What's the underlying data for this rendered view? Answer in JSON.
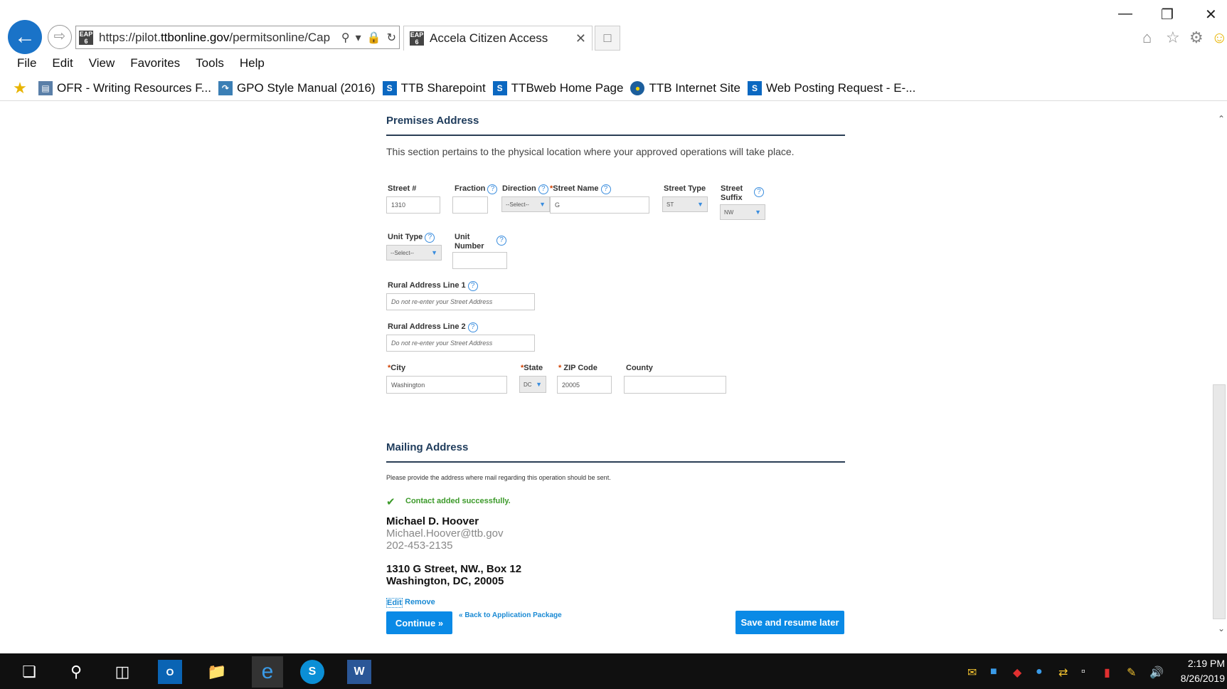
{
  "browser": {
    "url_prefix": "https://pilot.",
    "url_domain": "ttbonline.gov",
    "url_path": "/permitsonline/Cap",
    "tab_title": "Accela Citizen Access",
    "favicon_text": "EAP 6"
  },
  "menu": [
    "File",
    "Edit",
    "View",
    "Favorites",
    "Tools",
    "Help"
  ],
  "favorites": [
    {
      "label": "OFR - Writing Resources F...",
      "icon": "doc"
    },
    {
      "label": "GPO Style Manual (2016)",
      "icon": "gpo"
    },
    {
      "label": "TTB Sharepoint",
      "icon": "sp"
    },
    {
      "label": "TTBweb Home Page",
      "icon": "sp"
    },
    {
      "label": "TTB Internet Site",
      "icon": "seal"
    },
    {
      "label": "Web Posting Request - E-...",
      "icon": "sp"
    }
  ],
  "premises": {
    "title": "Premises Address",
    "description": "This section pertains to the physical location where your approved operations will take place.",
    "labels": {
      "street_no": "Street #",
      "fraction": "Fraction",
      "direction": "Direction",
      "street_name": "Street Name",
      "street_type": "Street Type",
      "street_suffix_1": "Street",
      "street_suffix_2": "Suffix",
      "unit_type": "Unit Type",
      "unit_number_1": "Unit",
      "unit_number_2": "Number",
      "rural1": "Rural Address Line 1",
      "rural2": "Rural Address Line 2",
      "city": "City",
      "state": "State",
      "zip": "ZIP Code",
      "county": "County"
    },
    "values": {
      "street_no": "1310",
      "fraction": "",
      "direction": "--Select--",
      "street_name": "G",
      "street_type": "ST",
      "street_suffix": "NW",
      "unit_type": "--Select--",
      "unit_number": "",
      "city": "Washington",
      "state": "DC",
      "zip": "20005",
      "county": ""
    },
    "placeholders": {
      "rural1": "Do not re-enter your Street Address",
      "rural2": "Do not re-enter your Street Address"
    }
  },
  "mailing": {
    "title": "Mailing Address",
    "description": "Please provide the address where mail regarding this operation should be sent.",
    "success": "Contact added successfully.",
    "contact_name": "Michael D. Hoover",
    "contact_email": "Michael.Hoover@ttb.gov",
    "contact_phone": "202-453-2135",
    "address_line1": "1310 G Street, NW., Box 12",
    "address_line2": "Washington, DC, 20005",
    "edit_link": "Edit",
    "remove_link": "Remove"
  },
  "actions": {
    "continue": "Continue »",
    "back": "« Back to Application Package",
    "save": "Save and resume later"
  },
  "clock": {
    "time": "2:19 PM",
    "date": "8/26/2019"
  },
  "colors": {
    "accent": "#0a8ae6",
    "heading": "#1f3c5c",
    "success": "#3c9a2a",
    "required": "#d04000"
  }
}
